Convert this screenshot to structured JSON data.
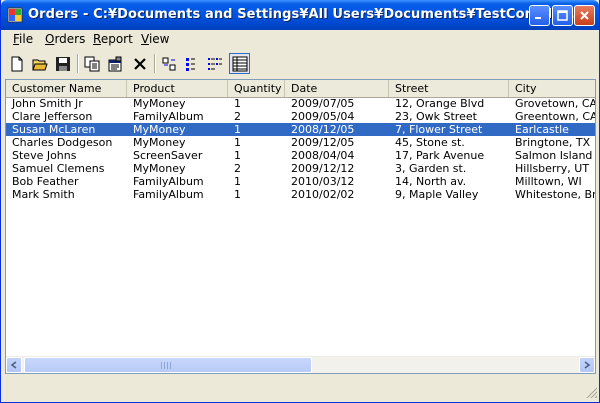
{
  "window": {
    "title": "Orders - C:¥Documents and Settings¥All Users¥Documents¥TestComplet..."
  },
  "menu": [
    {
      "hotkey": "F",
      "rest": "ile"
    },
    {
      "hotkey": "O",
      "rest": "rders"
    },
    {
      "hotkey": "R",
      "rest": "eport"
    },
    {
      "hotkey": "V",
      "rest": "iew"
    }
  ],
  "toolbar": {
    "icons": [
      "new-file-icon",
      "open-folder-icon",
      "save-icon",
      "copy-icon",
      "properties-icon",
      "delete-icon",
      "large-icons-view-icon",
      "small-icons-view-icon",
      "list-view-icon",
      "details-view-icon"
    ],
    "active": "details-view-icon"
  },
  "columns": [
    "Customer Name",
    "Product",
    "Quantity",
    "Date",
    "Street",
    "City"
  ],
  "rows": [
    {
      "name": "John Smith Jr",
      "product": "MyMoney",
      "qty": "1",
      "date": "2009/07/05",
      "street": "12, Orange Blvd",
      "city": "Grovetown, CA"
    },
    {
      "name": "Clare Jefferson",
      "product": "FamilyAlbum",
      "qty": "2",
      "date": "2009/05/04",
      "street": "23, Owk Street",
      "city": "Greentown, CA"
    },
    {
      "name": "Susan McLaren",
      "product": "MyMoney",
      "qty": "1",
      "date": "2008/12/05",
      "street": "7, Flower Street",
      "city": "Earlcastle"
    },
    {
      "name": "Charles Dodgeson",
      "product": "MyMoney",
      "qty": "1",
      "date": "2009/12/05",
      "street": "45, Stone st.",
      "city": "Bringtone, TX"
    },
    {
      "name": "Steve Johns",
      "product": "ScreenSaver",
      "qty": "1",
      "date": "2008/04/04",
      "street": "17, Park Avenue",
      "city": "Salmon Island"
    },
    {
      "name": "Samuel Clemens",
      "product": "MyMoney",
      "qty": "2",
      "date": "2009/12/12",
      "street": "3, Garden st.",
      "city": "Hillsberry, UT"
    },
    {
      "name": "Bob Feather",
      "product": "FamilyAlbum",
      "qty": "1",
      "date": "2010/03/12",
      "street": "14, North av.",
      "city": "Milltown, WI"
    },
    {
      "name": "Mark Smith",
      "product": "FamilyAlbum",
      "qty": "1",
      "date": "2010/02/02",
      "street": "9, Maple Valley",
      "city": "Whitestone, Brit"
    }
  ],
  "selected_row": 2,
  "colors": {
    "selection": "#316ac5",
    "titlebar": "#0054e3"
  }
}
